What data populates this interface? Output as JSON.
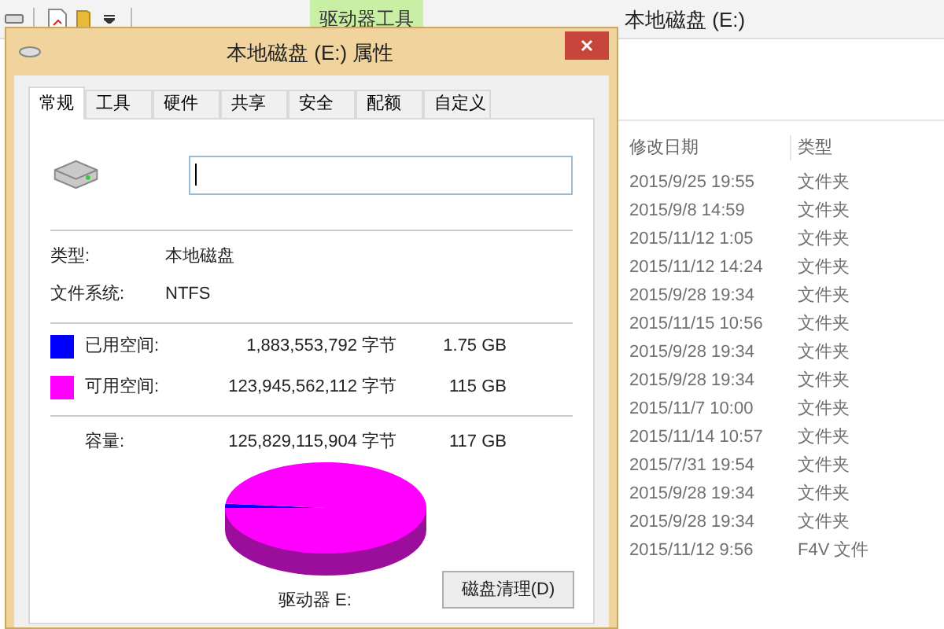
{
  "explorer": {
    "ribbon_tab": "驱动器工具",
    "title": "本地磁盘 (E:)",
    "columns": [
      "修改日期",
      "类型"
    ],
    "rows": [
      {
        "date": "2015/9/25 19:55",
        "type": "文件夹"
      },
      {
        "date": "2015/9/8 14:59",
        "type": "文件夹"
      },
      {
        "date": "2015/11/12 1:05",
        "type": "文件夹"
      },
      {
        "date": "2015/11/12 14:24",
        "type": "文件夹"
      },
      {
        "date": "2015/9/28 19:34",
        "type": "文件夹"
      },
      {
        "date": "2015/11/15 10:56",
        "type": "文件夹"
      },
      {
        "date": "2015/9/28 19:34",
        "type": "文件夹"
      },
      {
        "date": "2015/9/28 19:34",
        "type": "文件夹"
      },
      {
        "date": "2015/11/7 10:00",
        "type": "文件夹"
      },
      {
        "date": "2015/11/14 10:57",
        "type": "文件夹"
      },
      {
        "date": "2015/7/31 19:54",
        "type": "文件夹"
      },
      {
        "date": "2015/9/28 19:34",
        "type": "文件夹"
      },
      {
        "date": "2015/9/28 19:34",
        "type": "文件夹"
      },
      {
        "date": "2015/11/12 9:56",
        "type": "F4V 文件"
      }
    ]
  },
  "dialog": {
    "title": "本地磁盘 (E:) 属性",
    "tabs": [
      {
        "label": "常规",
        "selected": true
      },
      {
        "label": "工具",
        "selected": false
      },
      {
        "label": "硬件",
        "selected": false
      },
      {
        "label": "共享",
        "selected": false
      },
      {
        "label": "安全",
        "selected": false
      },
      {
        "label": "配额",
        "selected": false
      },
      {
        "label": "自定义",
        "selected": false
      }
    ],
    "type_label": "类型:",
    "type_value": "本地磁盘",
    "fs_label": "文件系统:",
    "fs_value": "NTFS",
    "spaces": [
      {
        "label": "已用空间:",
        "bytes": "1,883,553,792 字节",
        "size": "1.75 GB",
        "color": "#0000ff"
      },
      {
        "label": "可用空间:",
        "bytes": "123,945,562,112 字节",
        "size": "115 GB",
        "color": "#ff00ff"
      }
    ],
    "capacity": {
      "label": "容量:",
      "bytes": "125,829,115,904 字节",
      "size": "117 GB"
    },
    "drive_label": "驱动器 E:",
    "cleanup_button": "磁盘清理(D)"
  }
}
